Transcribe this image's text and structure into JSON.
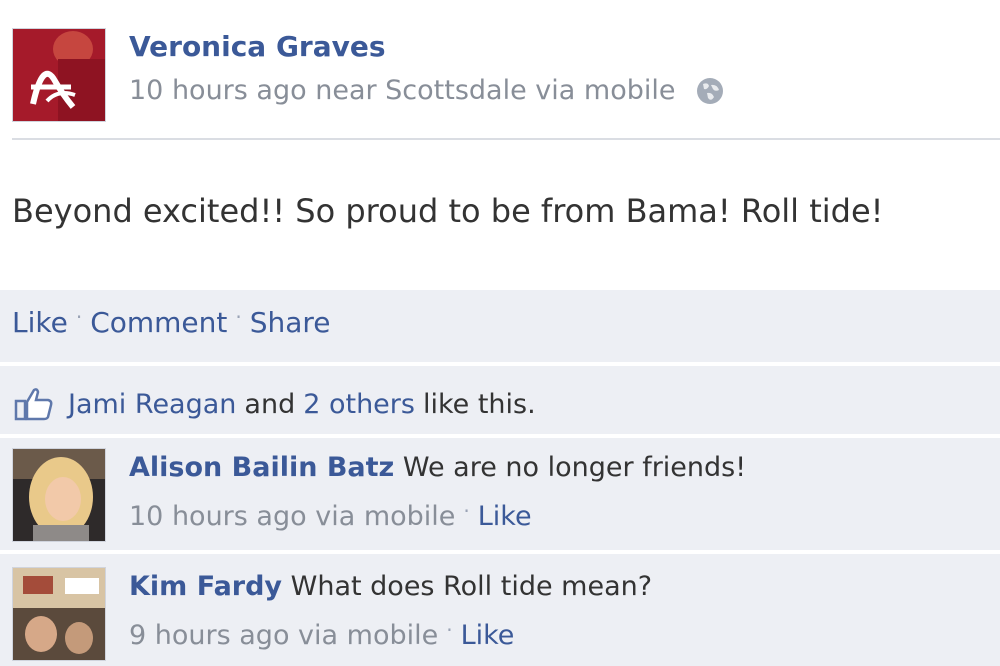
{
  "post": {
    "author": "Veronica Graves",
    "meta": "10 hours ago near Scottsdale via mobile",
    "body": "Beyond excited!! So proud to be from Bama! Roll tide!",
    "avatar_icon": "alabama-a-avatar-icon",
    "privacy_icon": "globe-icon"
  },
  "actions": {
    "like": "Like",
    "comment": "Comment",
    "share": "Share"
  },
  "likes": {
    "name": "Jami Reagan",
    "connector": "and",
    "others": "2 others",
    "suffix": "like this."
  },
  "comments": [
    {
      "author": "Alison Bailin Batz",
      "text": "We are no longer friends!",
      "meta": "10 hours ago via mobile",
      "like": "Like"
    },
    {
      "author": "Kim Fardy",
      "text": "What does Roll tide mean?",
      "meta": "9 hours ago via mobile",
      "like": "Like"
    }
  ],
  "colors": {
    "link": "#3b5998",
    "meta": "#888e98",
    "panel": "#edeff4"
  }
}
